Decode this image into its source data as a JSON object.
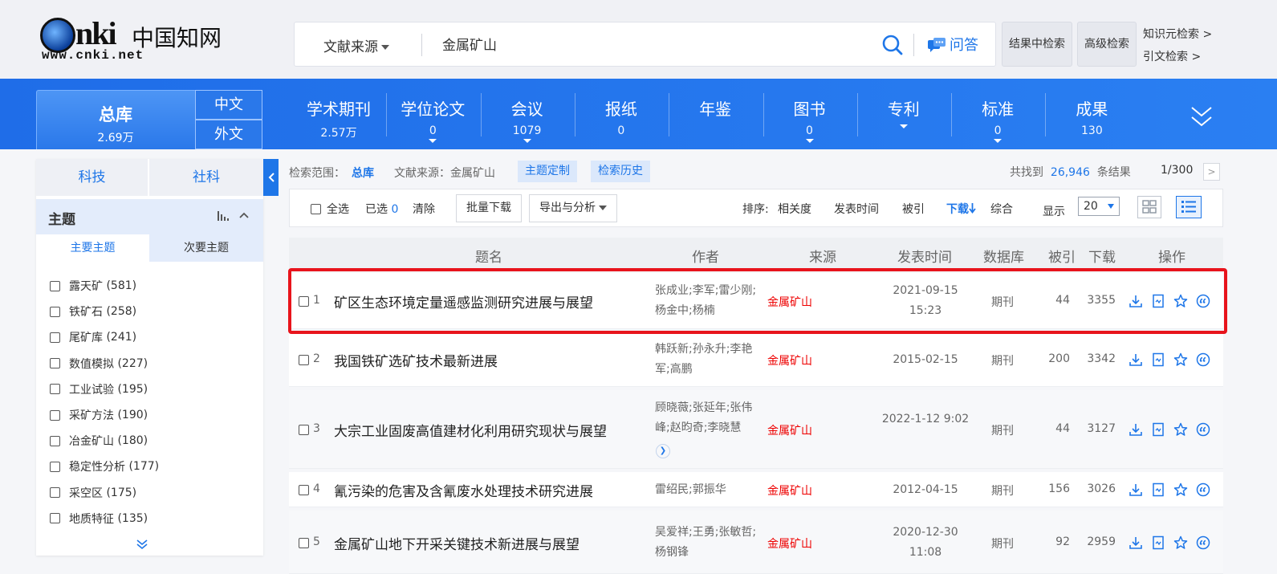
{
  "header": {
    "logo_text_nki": "nki",
    "logo_text_cn": "中国知网",
    "logo_url": "www.cnki.net",
    "search": {
      "source_label": "文献来源",
      "query": "金属矿山",
      "qa_label": "问答"
    },
    "btn_in_results": "结果中检索",
    "btn_advanced": "高级检索",
    "link_knowledge": "知识元检索 >",
    "link_citation": "引文检索 >"
  },
  "nav": {
    "total_label": "总库",
    "total_count": "2.69万",
    "lang_zh": "中文",
    "lang_en": "外文",
    "items": [
      {
        "name": "学术期刊",
        "count": "2.57万",
        "dropdown": false
      },
      {
        "name": "学位论文",
        "count": "0",
        "dropdown": true
      },
      {
        "name": "会议",
        "count": "1079",
        "dropdown": true
      },
      {
        "name": "报纸",
        "count": "0",
        "dropdown": false
      },
      {
        "name": "年鉴",
        "count": "",
        "dropdown": false
      },
      {
        "name": "图书",
        "count": "0",
        "dropdown": true
      },
      {
        "name": "专利",
        "count": "",
        "dropdown": true
      },
      {
        "name": "标准",
        "count": "0",
        "dropdown": true
      },
      {
        "name": "成果",
        "count": "130",
        "dropdown": false
      }
    ]
  },
  "sidebar": {
    "tab_sci": "科技",
    "tab_social": "社科",
    "topic_label": "主题",
    "sub_primary": "主要主题",
    "sub_secondary": "次要主题",
    "topics": [
      {
        "label": "露天矿",
        "count": "(581)"
      },
      {
        "label": "铁矿石",
        "count": "(258)"
      },
      {
        "label": "尾矿库",
        "count": "(241)"
      },
      {
        "label": "数值模拟",
        "count": "(227)"
      },
      {
        "label": "工业试验",
        "count": "(195)"
      },
      {
        "label": "采矿方法",
        "count": "(190)"
      },
      {
        "label": "冶金矿山",
        "count": "(180)"
      },
      {
        "label": "稳定性分析",
        "count": "(177)"
      },
      {
        "label": "采空区",
        "count": "(175)"
      },
      {
        "label": "地质特征",
        "count": "(135)"
      }
    ]
  },
  "scope": {
    "range_label": "检索范围：",
    "range_value": "总库",
    "source_label": "文献来源：金属矿山",
    "btn_topic": "主题定制",
    "btn_history": "检索历史",
    "found_prefix": "共找到",
    "found_count": "26,946",
    "found_suffix": "条结果",
    "page": "1/300",
    "next": ">"
  },
  "toolbar": {
    "select_all": "全选",
    "selected_label": "已选",
    "selected_count": "0",
    "clear": "清除",
    "batch_download": "批量下载",
    "export": "导出与分析",
    "sort_label": "排序:",
    "sort_relevance": "相关度",
    "sort_date": "发表时间",
    "sort_cited": "被引",
    "sort_download": "下载",
    "sort_composite": "综合",
    "display_label": "显示",
    "display_value": "20"
  },
  "table": {
    "headers": {
      "title": "题名",
      "author": "作者",
      "source": "来源",
      "date": "发表时间",
      "db": "数据库",
      "cited": "被引",
      "downloads": "下载",
      "ops": "操作"
    },
    "rows": [
      {
        "idx": "1",
        "title": "矿区生态环境定量遥感监测研究进展与展望",
        "authors": "张成业;李军;雷少刚;杨金中;杨楠",
        "source": "金属矿山",
        "date": "2021-09-15 15:23",
        "db": "期刊",
        "cited": "44",
        "downloads": "3355"
      },
      {
        "idx": "2",
        "title": "我国铁矿选矿技术最新进展",
        "authors": "韩跃新;孙永升;李艳军;高鹏",
        "source": "金属矿山",
        "date": "2015-02-15",
        "db": "期刊",
        "cited": "200",
        "downloads": "3342"
      },
      {
        "idx": "3",
        "title": "大宗工业固废高值建材化利用研究现状与展望",
        "authors": "顾晓薇;张延年;张伟峰;赵昀奇;李晓慧",
        "source": "金属矿山",
        "date": "2022-1-12 9:02",
        "db": "期刊",
        "cited": "44",
        "downloads": "3127"
      },
      {
        "idx": "4",
        "title": "氰污染的危害及含氰废水处理技术研究进展",
        "authors": "雷绍民;郭振华",
        "source": "金属矿山",
        "date": "2012-04-15",
        "db": "期刊",
        "cited": "156",
        "downloads": "3026"
      },
      {
        "idx": "5",
        "title": "金属矿山地下开采关键技术新进展与展望",
        "authors": "吴爱祥;王勇;张敏哲;杨钢锋",
        "source": "金属矿山",
        "date": "2020-12-30 11:08",
        "db": "期刊",
        "cited": "92",
        "downloads": "2959"
      }
    ]
  },
  "colors": {
    "brand_blue": "#1e76e8",
    "source_red": "#e00000",
    "highlight_red": "#e8141c"
  }
}
